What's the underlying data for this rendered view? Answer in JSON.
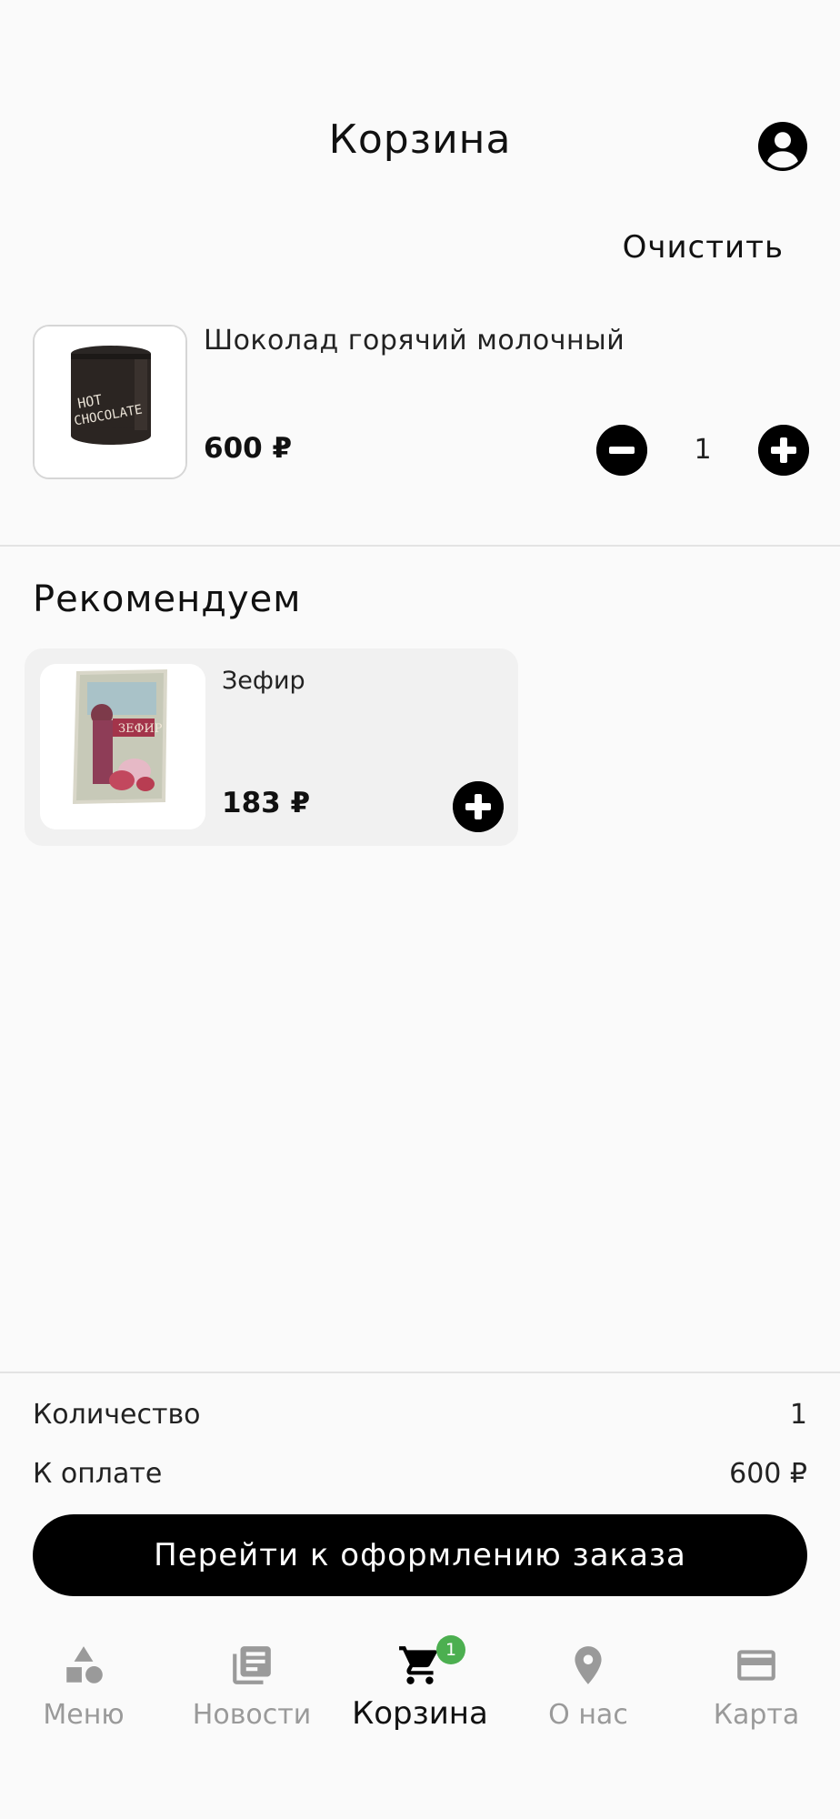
{
  "header": {
    "title": "Корзина",
    "profile_icon": "account-circle-icon"
  },
  "actions": {
    "clear_label": "Очистить"
  },
  "cart": {
    "items": [
      {
        "name": "Шоколад горячий молочный",
        "price": "600 ₽",
        "quantity": "1",
        "image_label": "HOT CHOCOLATE"
      }
    ]
  },
  "recommendations": {
    "title": "Рекомендуем",
    "items": [
      {
        "name": "Зефир",
        "price": "183 ₽",
        "image_label": "ЗЕФИР"
      }
    ]
  },
  "summary": {
    "quantity_label": "Количество",
    "quantity_value": "1",
    "total_label": "К оплате",
    "total_value": "600 ₽"
  },
  "checkout": {
    "label": "Перейти к оформлению заказа"
  },
  "bottom_nav": {
    "items": [
      {
        "label": "Меню",
        "icon": "category-shapes-icon",
        "active": false
      },
      {
        "label": "Новости",
        "icon": "news-library-icon",
        "active": false
      },
      {
        "label": "Корзина",
        "icon": "cart-icon",
        "active": true,
        "badge": "1"
      },
      {
        "label": "О нас",
        "icon": "location-pin-icon",
        "active": false
      },
      {
        "label": "Карта",
        "icon": "credit-card-icon",
        "active": false
      }
    ]
  },
  "colors": {
    "accent": "#000000",
    "background": "#fafafa",
    "badge": "#4caf50",
    "inactive_nav": "#9a9a9a",
    "card_bg": "#f1f1f1"
  }
}
